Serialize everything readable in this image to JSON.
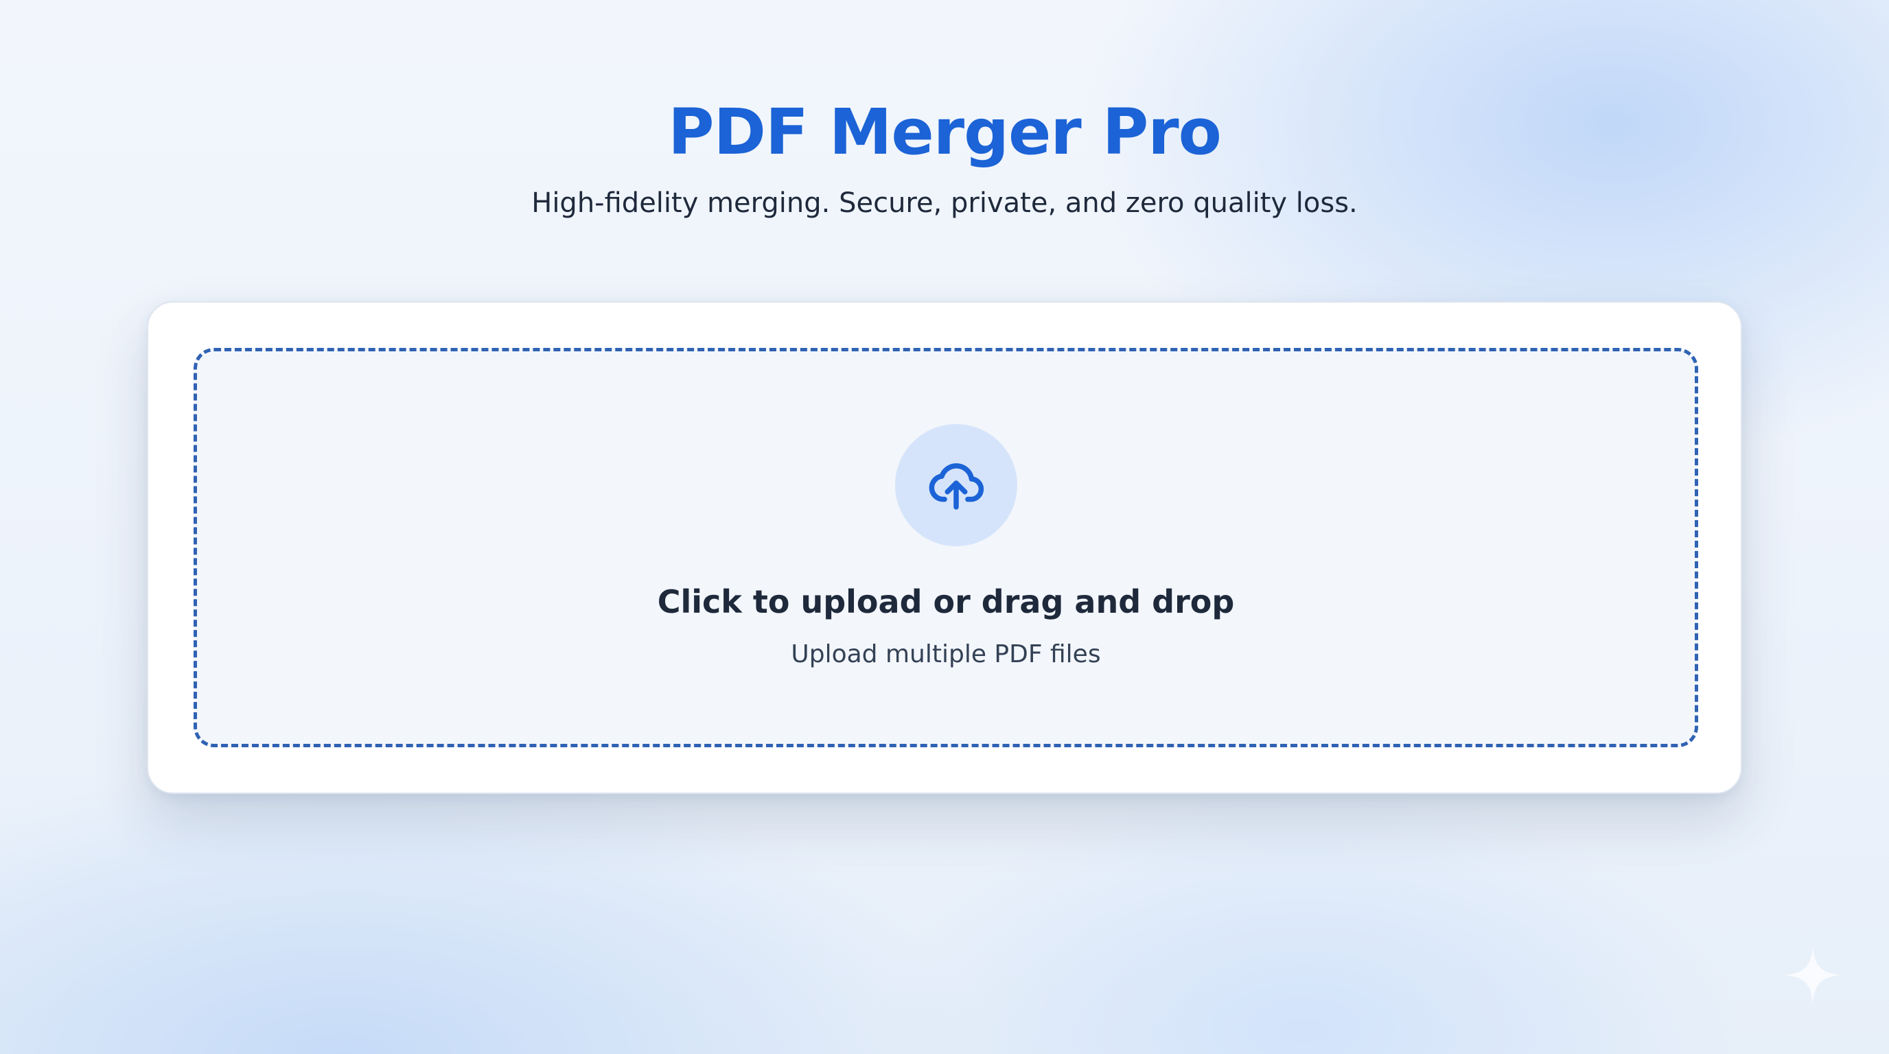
{
  "header": {
    "title": "PDF Merger Pro",
    "subtitle": "High-fidelity merging. Secure, private, and zero quality loss."
  },
  "upload": {
    "icon": "cloud-upload-icon",
    "title": "Click to upload or drag and drop",
    "subtitle": "Upload multiple PDF files"
  },
  "decor": {
    "corner_icon": "sparkle-icon"
  },
  "colors": {
    "accent": "#1b63d6",
    "dropzone_border": "#2f62b3",
    "icon_circle": "#d5e4fa",
    "text_primary": "#1e293b",
    "card_background": "#ffffff"
  }
}
